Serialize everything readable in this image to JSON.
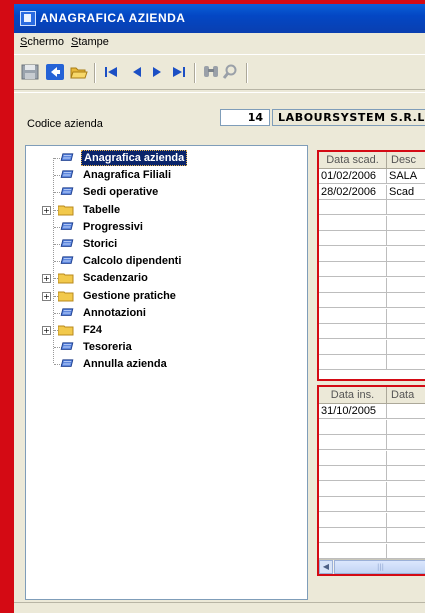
{
  "window": {
    "title": "ANAGRAFICA AZIENDA"
  },
  "menu": {
    "items": [
      {
        "accel": "S",
        "rest": "chermo"
      },
      {
        "accel": "S",
        "rest": "tampe"
      }
    ]
  },
  "toolbar": {
    "icons": [
      "save-icon",
      "back-icon",
      "open-folder-icon",
      "first-record-icon",
      "prev-record-icon",
      "next-record-icon",
      "last-record-icon",
      "binoculars-icon",
      "search-icon"
    ]
  },
  "company": {
    "label": "Codice azienda",
    "code": "14",
    "name": "LABOURSYSTEM S.R.L."
  },
  "tree": {
    "items": [
      {
        "label": "Anagrafica azienda",
        "kind": "doc",
        "selected": true
      },
      {
        "label": "Anagrafica Filiali",
        "kind": "doc"
      },
      {
        "label": "Sedi operative",
        "kind": "doc"
      },
      {
        "label": "Tabelle",
        "kind": "folder",
        "expandable": true
      },
      {
        "label": "Progressivi",
        "kind": "doc"
      },
      {
        "label": "Storici",
        "kind": "doc"
      },
      {
        "label": "Calcolo dipendenti",
        "kind": "doc"
      },
      {
        "label": "Scadenzario",
        "kind": "folder",
        "expandable": true
      },
      {
        "label": "Gestione pratiche",
        "kind": "folder",
        "expandable": true
      },
      {
        "label": "Annotazioni",
        "kind": "doc"
      },
      {
        "label": "F24",
        "kind": "folder",
        "expandable": true
      },
      {
        "label": "Tesoreria",
        "kind": "doc"
      },
      {
        "label": "Annulla azienda",
        "kind": "doc"
      }
    ]
  },
  "deadlines_grid": {
    "columns": [
      "Data scad.",
      "Desc"
    ],
    "rows": [
      [
        "01/02/2006",
        "SALA"
      ],
      [
        "28/02/2006",
        "Scad"
      ]
    ]
  },
  "notes_grid": {
    "columns": [
      "Data ins.",
      "Data"
    ],
    "rows": [
      [
        "31/10/2005",
        ""
      ]
    ]
  },
  "colors": {
    "frame_red": "#d40a14",
    "selection": "#0a246a",
    "titlebar": "#0347c4"
  }
}
